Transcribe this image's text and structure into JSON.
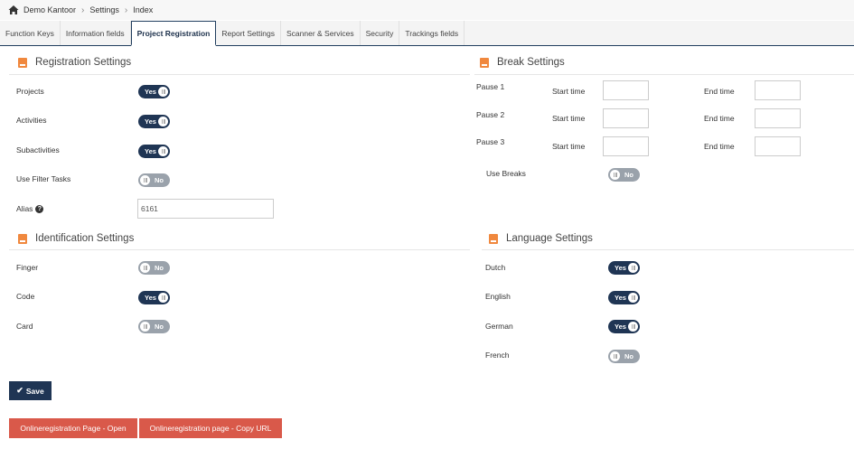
{
  "breadcrumb": {
    "home": "Demo Kantoor",
    "settings": "Settings",
    "current": "Index"
  },
  "tabs": [
    {
      "label": "Function Keys"
    },
    {
      "label": "Information fields"
    },
    {
      "label": "Project Registration",
      "active": true
    },
    {
      "label": "Report Settings"
    },
    {
      "label": "Scanner & Services"
    },
    {
      "label": "Security"
    },
    {
      "label": "Trackings fields"
    }
  ],
  "registration": {
    "title": "Registration Settings",
    "projects": {
      "label": "Projects",
      "value": "Yes"
    },
    "activities": {
      "label": "Activities",
      "value": "Yes"
    },
    "subactivities": {
      "label": "Subactivities",
      "value": "Yes"
    },
    "filter_tasks": {
      "label": "Use Filter Tasks",
      "value": "No"
    },
    "alias": {
      "label": "Alias",
      "value": "6161"
    }
  },
  "identification": {
    "title": "Identification Settings",
    "finger": {
      "label": "Finger",
      "value": "No"
    },
    "code": {
      "label": "Code",
      "value": "Yes"
    },
    "card": {
      "label": "Card",
      "value": "No"
    }
  },
  "breaks": {
    "title": "Break Settings",
    "start_label": "Start time",
    "end_label": "End time",
    "pauses": [
      {
        "label": "Pause 1",
        "start": "",
        "end": ""
      },
      {
        "label": "Pause 2",
        "start": "",
        "end": ""
      },
      {
        "label": "Pause 3",
        "start": "",
        "end": ""
      }
    ],
    "use_breaks": {
      "label": "Use Breaks",
      "value": "No"
    }
  },
  "language": {
    "title": "Language Settings",
    "dutch": {
      "label": "Dutch",
      "value": "Yes"
    },
    "english": {
      "label": "English",
      "value": "Yes"
    },
    "german": {
      "label": "German",
      "value": "Yes"
    },
    "french": {
      "label": "French",
      "value": "No"
    }
  },
  "buttons": {
    "save": "Save",
    "open_page": "Onlineregistration Page - Open",
    "copy_url": "Onlineregistration page - Copy URL"
  },
  "colors": {
    "primary": "#1f3554",
    "accent": "#f0883e",
    "danger": "#d9594a",
    "toggle_off": "#9aa2ab"
  }
}
